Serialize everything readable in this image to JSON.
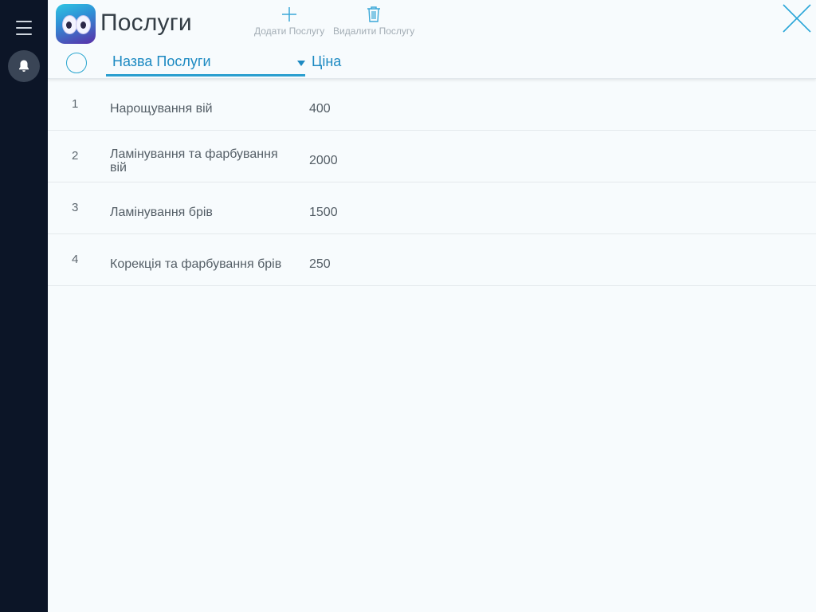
{
  "header": {
    "title": "Послуги",
    "add_label": "Додати Послугу",
    "delete_label": "Видалити Послугу"
  },
  "columns": {
    "name": "Назва Послуги",
    "price": "Ціна"
  },
  "rows": [
    {
      "num": "1",
      "name": "Нарощування вій",
      "price": "400"
    },
    {
      "num": "2",
      "name": "Ламінування та фарбування вій",
      "price": "2000"
    },
    {
      "num": "3",
      "name": "Ламінування брів",
      "price": "1500"
    },
    {
      "num": "4",
      "name": "Корекція та фарбування брів",
      "price": "250"
    }
  ],
  "icons": {
    "menu": "hamburger-icon",
    "notifications": "bell-icon",
    "add": "plus-icon",
    "delete": "trash-icon",
    "close": "close-icon",
    "sort": "triangle-down-icon"
  },
  "colors": {
    "accent": "#2b9fd0",
    "sidebar": "#0c1527",
    "background": "#f7fbfd"
  }
}
